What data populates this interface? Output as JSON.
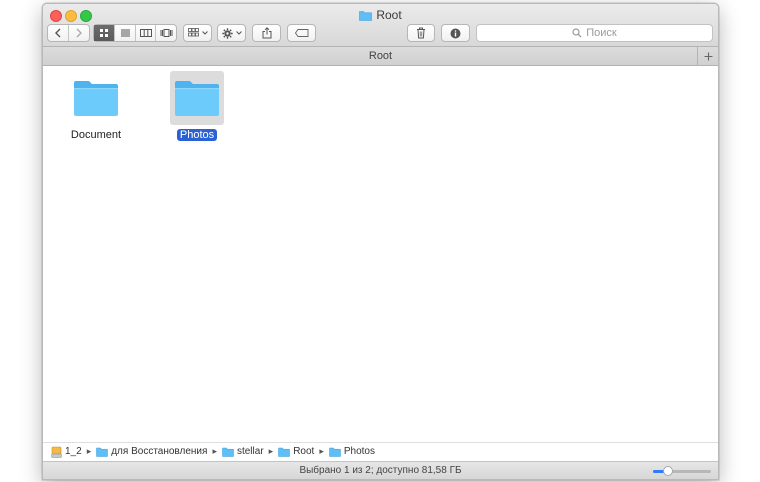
{
  "window": {
    "title": "Root",
    "title_icon": "folder-icon"
  },
  "toolbar": {
    "nav": [
      "chevron-left-icon",
      "chevron-right-icon"
    ],
    "views": [
      "icon-view-icon",
      "list-view-icon",
      "column-view-icon",
      "coverflow-view-icon"
    ],
    "active_view": 0,
    "arrange_icon": "arrange-icon",
    "action_icon": "gear-icon",
    "share_icon": "share-icon",
    "tag_icon": "tag-icon",
    "delete_icon": "trash-icon",
    "info_icon": "info-icon",
    "search_placeholder": "Поиск"
  },
  "tabbar": {
    "title": "Root",
    "add_icon": "plus-icon"
  },
  "items": [
    {
      "name": "Document",
      "selected": false,
      "icon": "folder-icon"
    },
    {
      "name": "Photos",
      "selected": true,
      "icon": "folder-icon"
    }
  ],
  "path": [
    {
      "label": "1_2",
      "icon": "drive-icon"
    },
    {
      "label": "для Восстановления",
      "icon": "folder-icon"
    },
    {
      "label": "stellar",
      "icon": "folder-icon"
    },
    {
      "label": "Root",
      "icon": "folder-icon"
    },
    {
      "label": "Photos",
      "icon": "folder-icon"
    }
  ],
  "status": {
    "text": "Выбрано 1 из 2; доступно 81,58 ГБ",
    "zoom": 0.25
  },
  "colors": {
    "folder": "#5fc3f8",
    "selection": "#2a62d6",
    "accent": "#2f7cf6"
  }
}
